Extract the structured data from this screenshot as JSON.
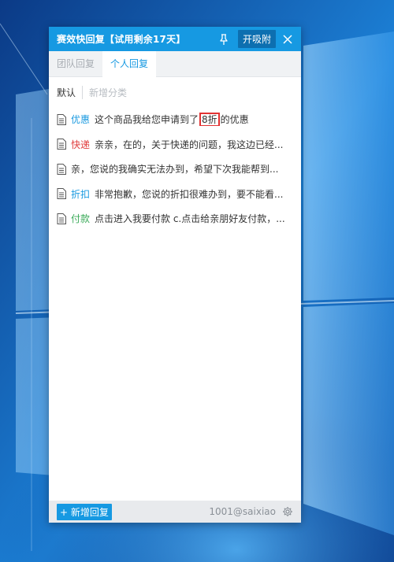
{
  "window": {
    "title": "赛效快回复【试用剩余17天】",
    "pin_icon": "pin-icon",
    "attach_label": "开吸附",
    "close_icon": "close-icon"
  },
  "tabs": [
    {
      "label": "团队回复",
      "active": false
    },
    {
      "label": "个人回复",
      "active": true
    }
  ],
  "categories": {
    "default_label": "默认",
    "add_label": "新增分类"
  },
  "replies": [
    {
      "tag": "优惠",
      "tag_color": "#1a9ae0",
      "text_before": "这个商品我给您申请到了",
      "highlight": "8折",
      "text_after": "的优惠"
    },
    {
      "tag": "快递",
      "tag_color": "#e03c3c",
      "text": "亲亲，在的，关于快递的问题，我这边已经..."
    },
    {
      "tag": "",
      "tag_color": "",
      "text": "亲，您说的我确实无法办到，希望下次我能帮到..."
    },
    {
      "tag": "折扣",
      "tag_color": "#1a9ae0",
      "text": "非常抱歉，您说的折扣很难办到，要不能看..."
    },
    {
      "tag": "付款",
      "tag_color": "#3bab5a",
      "text": "点击进入我要付款 c.点击给亲朋好友付款，..."
    }
  ],
  "footer": {
    "add_reply_label": "+ 新增回复",
    "account": "1001@saixiao",
    "settings_icon": "gear-icon"
  },
  "colors": {
    "accent": "#1699e2",
    "highlight_border": "#e23232"
  }
}
